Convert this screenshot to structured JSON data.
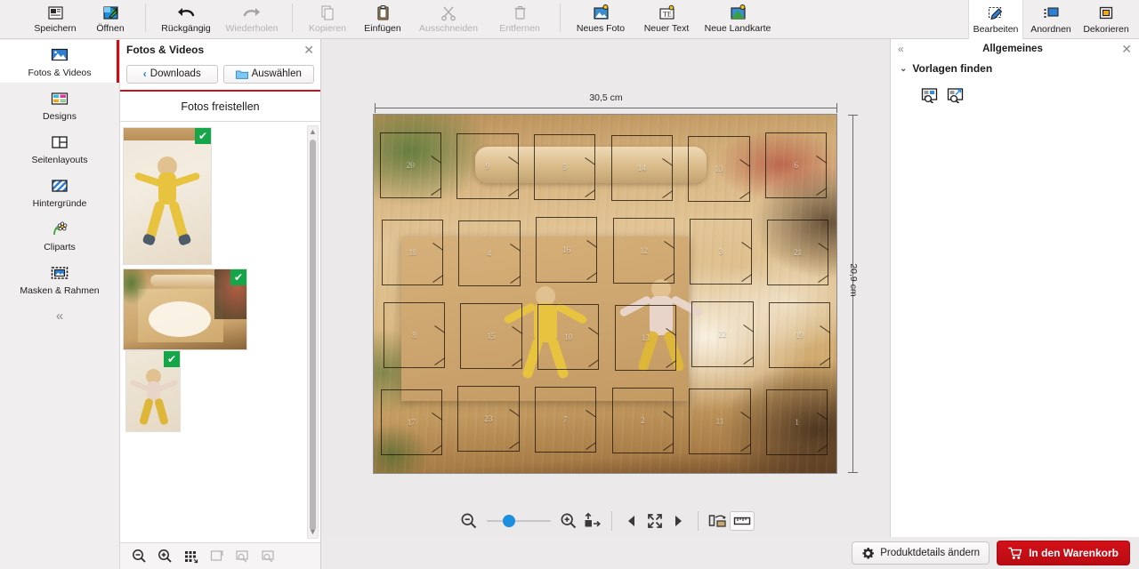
{
  "toolbar": {
    "groups": [
      {
        "items": [
          {
            "label": "Speichern",
            "icon": "save-icon",
            "enabled": true
          },
          {
            "label": "Öffnen",
            "icon": "open-folder-icon",
            "enabled": true
          }
        ]
      },
      {
        "items": [
          {
            "label": "Rückgängig",
            "icon": "undo-arrow-icon",
            "enabled": true
          },
          {
            "label": "Wiederholen",
            "icon": "redo-arrow-icon",
            "enabled": false
          }
        ]
      },
      {
        "items": [
          {
            "label": "Kopieren",
            "icon": "copy-icon",
            "enabled": false
          },
          {
            "label": "Einfügen",
            "icon": "paste-icon",
            "enabled": true
          },
          {
            "label": "Ausschneiden",
            "icon": "scissors-icon",
            "enabled": false
          },
          {
            "label": "Entfernen",
            "icon": "trash-icon",
            "enabled": false
          }
        ]
      },
      {
        "items": [
          {
            "label": "Neues Foto",
            "icon": "new-photo-icon",
            "enabled": true
          },
          {
            "label": "Neuer Text",
            "icon": "new-text-icon",
            "enabled": true
          },
          {
            "label": "Neue Landkarte",
            "icon": "new-map-icon",
            "enabled": true
          }
        ]
      }
    ],
    "modes": [
      {
        "label": "Bearbeiten",
        "icon": "edit-icon",
        "active": true
      },
      {
        "label": "Anordnen",
        "icon": "arrange-icon",
        "active": false
      },
      {
        "label": "Dekorieren",
        "icon": "decorate-icon",
        "active": false
      }
    ]
  },
  "rail": {
    "items": [
      {
        "label": "Fotos & Videos",
        "icon": "photos-videos-icon",
        "active": true
      },
      {
        "label": "Designs",
        "icon": "designs-icon",
        "active": false
      },
      {
        "label": "Seitenlayouts",
        "icon": "page-layouts-icon",
        "active": false
      },
      {
        "label": "Hintergründe",
        "icon": "backgrounds-icon",
        "active": false
      },
      {
        "label": "Cliparts",
        "icon": "cliparts-icon",
        "active": false
      },
      {
        "label": "Masken & Rahmen",
        "icon": "masks-frames-icon",
        "active": false
      }
    ],
    "collapse": "«"
  },
  "panel": {
    "title": "Fotos & Videos",
    "close": "✕",
    "back_label": "Downloads",
    "select_label": "Auswählen",
    "subtitle": "Fotos freistellen",
    "thumbnails": [
      {
        "name": "child-on-bedsheet-yellow",
        "selected": true,
        "check": "✔"
      },
      {
        "name": "flour-board-baking",
        "selected": true,
        "check": "✔"
      },
      {
        "name": "child-snow-angel-yellow-pants",
        "selected": true,
        "check": "✔"
      }
    ],
    "footer_icons": [
      {
        "name": "zoom-out-icon",
        "enabled": true
      },
      {
        "name": "zoom-in-icon",
        "enabled": true
      },
      {
        "name": "grid-view-icon",
        "enabled": true
      },
      {
        "name": "rotate-icon",
        "enabled": false
      },
      {
        "name": "preview-icon",
        "enabled": false
      },
      {
        "name": "search-photo-icon",
        "enabled": false
      }
    ]
  },
  "canvas": {
    "width_label": "30,5 cm",
    "height_label": "20,9 cm",
    "calendar_numbers": [
      [
        "20",
        "9",
        "5",
        "14",
        "13",
        "6"
      ],
      [
        "18",
        "4",
        "16",
        "12",
        "3",
        "21"
      ],
      [
        "8",
        "15",
        "10",
        "13",
        "22",
        "19"
      ],
      [
        "17",
        "23",
        "7",
        "2",
        "11",
        "1"
      ]
    ]
  },
  "canvas_bar": {
    "zoom_out_icon": "zoom-out-icon",
    "zoom_in_icon": "zoom-in-icon",
    "fit_icon": "fit-to-object-icon",
    "prev_icon": "previous-page-icon",
    "fullscreen_icon": "fullscreen-icon",
    "next_icon": "next-page-icon",
    "spread_icon": "page-spread-icon",
    "ruler_icon": "ruler-icon",
    "zoom_value": 25
  },
  "right_panel": {
    "collapse": "«",
    "title": "Allgemeines",
    "close": "✕",
    "section": {
      "caret": "⌄",
      "label": "Vorlagen finden",
      "buttons": [
        {
          "name": "find-template-icon"
        },
        {
          "name": "find-template-alt-icon"
        }
      ]
    }
  },
  "bottom": {
    "product_details_label": "Produktdetails ändern",
    "cart_label": "In den Warenkorb",
    "gear_icon": "gear-icon",
    "cart_icon": "cart-icon"
  },
  "colors": {
    "accent_red": "#d20a11",
    "cart_red": "#c8151c",
    "check_green": "#16a64a",
    "slider_blue": "#1d8fe0"
  }
}
